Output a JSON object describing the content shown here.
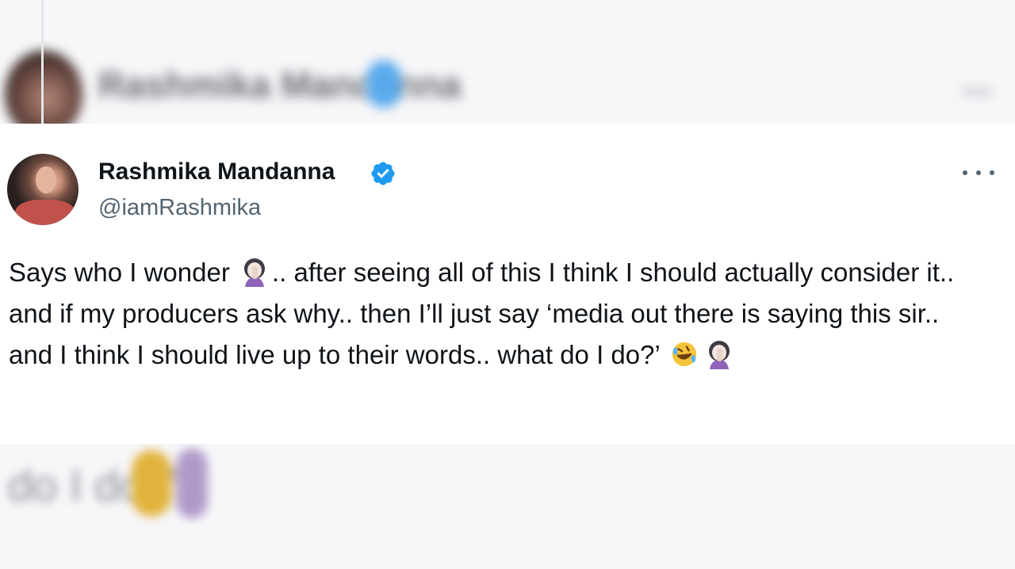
{
  "tweet": {
    "display_name": "Rashmika Mandanna",
    "handle": "@iamRashmika",
    "text_parts": [
      "Says who I wonder",
      ".. after seeing all of this I think I should actually consider it.. and if my producers ask why.. then I’ll just say ‘media out there is saying this sir.. and I think I should live up to their words.. what do I do?’"
    ],
    "verified": true,
    "icons": {
      "verified": "verified-badge-icon",
      "more": "more-options-icon",
      "emoji_facepalm": "woman-facepalming-emoji",
      "emoji_laugh": "rolling-on-floor-laughing-emoji"
    }
  },
  "blurred_top": {
    "display_name": "Rashmika Mandanna"
  },
  "blurred_bottom": {
    "text": "do I do?’"
  },
  "colors": {
    "verified": "#1d9bf0",
    "text_primary": "#0f1419",
    "text_secondary": "#536471"
  }
}
